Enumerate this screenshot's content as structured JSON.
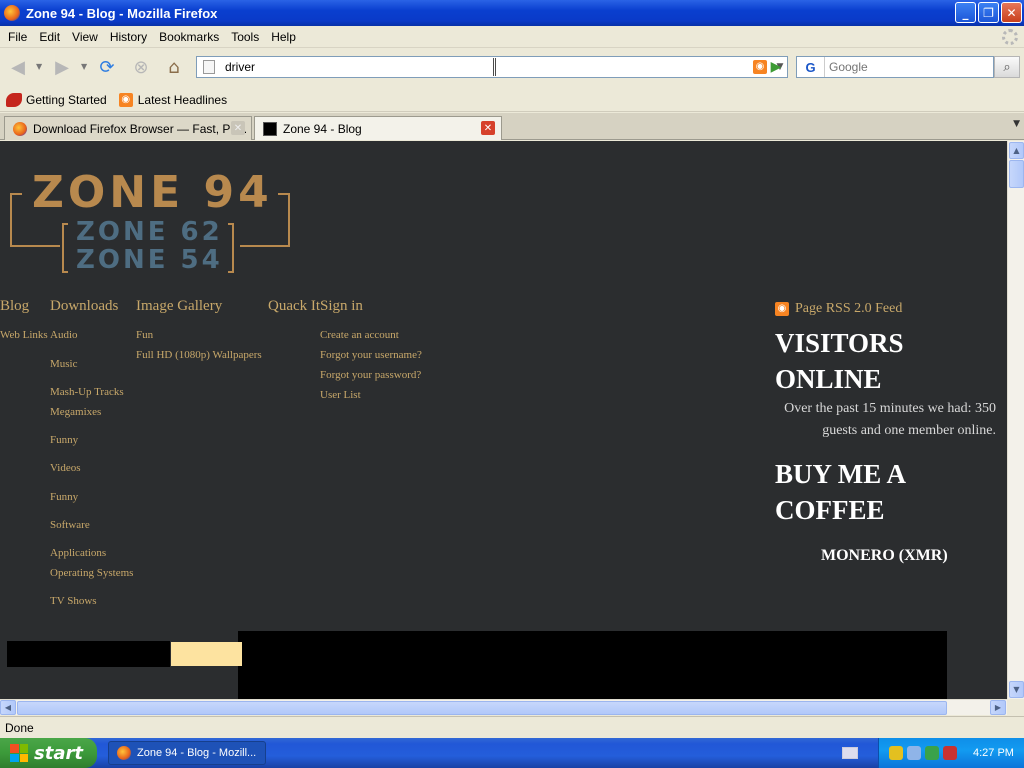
{
  "window": {
    "title": "Zone 94 - Blog - Mozilla Firefox",
    "minimize_glyph": "_",
    "restore_glyph": "❐",
    "close_glyph": "✕"
  },
  "menu": [
    "File",
    "Edit",
    "View",
    "History",
    "Bookmarks",
    "Tools",
    "Help"
  ],
  "toolbar": {
    "url": "driver",
    "search_placeholder": "Google",
    "search_engine_glyph": "G"
  },
  "bookmarks": [
    {
      "label": "Getting Started",
      "icon": "getting-started-icon"
    },
    {
      "label": "Latest Headlines",
      "icon": "rss-icon"
    }
  ],
  "tabs": [
    {
      "label": "Download Firefox Browser — Fast, Pri...",
      "active": false
    },
    {
      "label": "Zone 94 - Blog",
      "active": true
    }
  ],
  "page": {
    "logo": {
      "main": "ZONE 94",
      "sub1": "ZONE 62",
      "sub2": "ZONE 54"
    },
    "nav": {
      "blog": "Blog",
      "downloads": "Downloads",
      "image_gallery": "Image Gallery",
      "quack_it": "Quack It",
      "sign_in": "Sign in",
      "web_links": "Web Links",
      "downloads_sub": [
        "Audio",
        "Music",
        "Mash-Up Tracks",
        "Megamixes",
        "Funny",
        "Videos",
        "Funny",
        "Software",
        "Applications",
        "Operating Systems",
        "TV Shows"
      ],
      "gallery_sub": [
        "Fun",
        "Full HD (1080p) Wallpapers"
      ],
      "signin_sub": [
        "Create an account",
        "Forgot your username?",
        "Forgot your password?",
        "User List"
      ]
    },
    "rss_feed": "Page RSS 2.0 Feed",
    "visitors_heading": "VISITORS ONLINE",
    "visitors_text": "Over the past 15 minutes we had: 350 guests and one member online.",
    "coffee_heading": "BUY ME A COFFEE",
    "monero": "MONERO (XMR)"
  },
  "status": "Done",
  "taskbar": {
    "start": "start",
    "task": "Zone 94 - Blog - Mozill...",
    "time": "4:27 PM"
  },
  "colors": {
    "page_bg": "#2b2d2f",
    "nav_link": "#c8a86a",
    "logo_gold": "#b8894e",
    "logo_blue": "#4e6d82"
  }
}
